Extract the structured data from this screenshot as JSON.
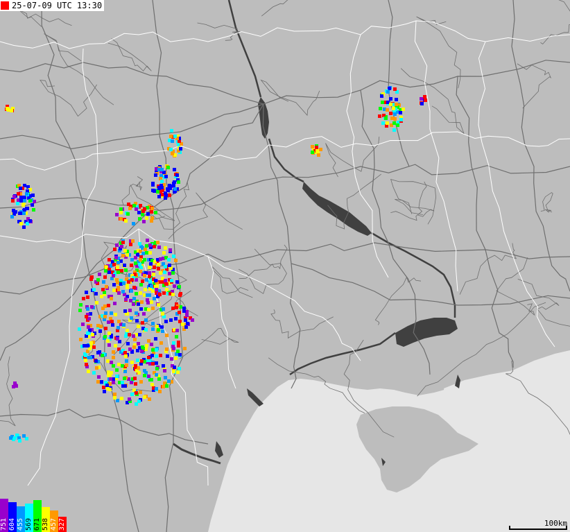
{
  "timestamp": {
    "text": "25-07-09 UTC 13:30",
    "marker_color": "#ff0000"
  },
  "scale": {
    "label": "100km"
  },
  "colors": {
    "land": "#bdbdbd",
    "sea": "#e6e6e6",
    "water": "#404040",
    "roads": "#6e6e6e",
    "borders": "#ffffff"
  },
  "legend": [
    {
      "label": "751",
      "color": "#9900cc",
      "level": 1.0
    },
    {
      "label": "604",
      "color": "#0000ff",
      "level": 0.9
    },
    {
      "label": "455",
      "color": "#0099ff",
      "level": 0.78
    },
    {
      "label": "569",
      "color": "#00ffff",
      "level": 0.86
    },
    {
      "label": "671",
      "color": "#00ff00",
      "level": 0.95
    },
    {
      "label": "538",
      "color": "#ffff00",
      "level": 0.76
    },
    {
      "label": "457",
      "color": "#ff9900",
      "level": 0.64
    },
    {
      "label": "327",
      "color": "#ff0000",
      "level": 0.46
    }
  ]
}
